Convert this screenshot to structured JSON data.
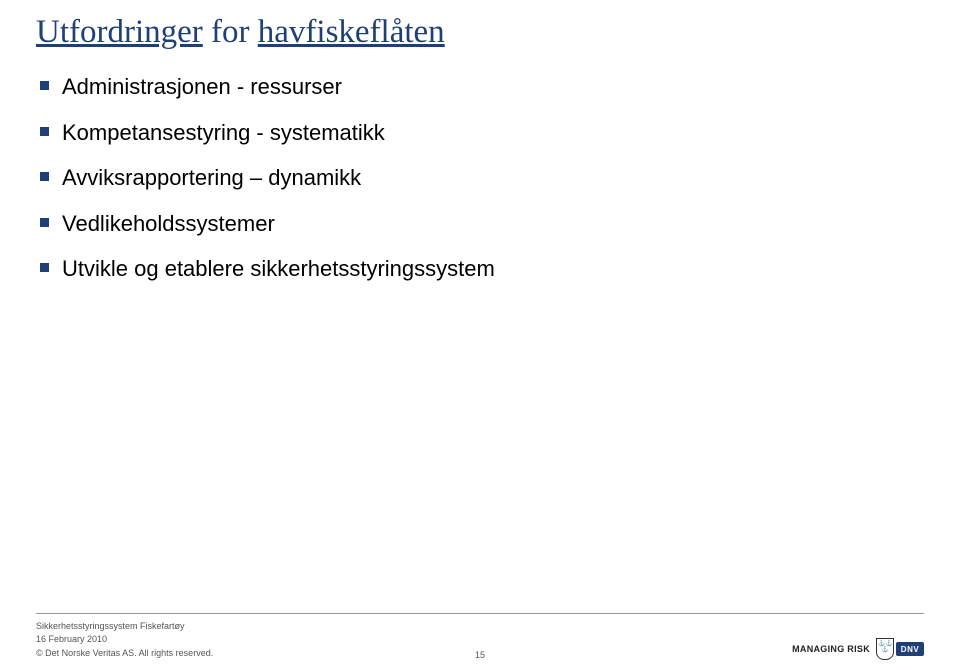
{
  "title_part1": "Utfordringer",
  "title_part2": " for ",
  "title_part3": "havfiskeflåten",
  "bullets": {
    "b0": "Administrasjonen - ressurser",
    "b1": "Kompetansestyring - systematikk",
    "b2": "Avviksrapportering – dynamikk",
    "b3": "Vedlikeholdssystemer",
    "b4": "Utvikle og etablere sikkerhetsstyringssystem"
  },
  "footer": {
    "project": "Sikkerhetsstyringssystem Fiskefartøy",
    "date": "16 February 2010",
    "copyright": "© Det Norske Veritas AS. All rights reserved.",
    "page_number": "15",
    "tagline": "MANAGING RISK",
    "logo_text": "DNV"
  }
}
